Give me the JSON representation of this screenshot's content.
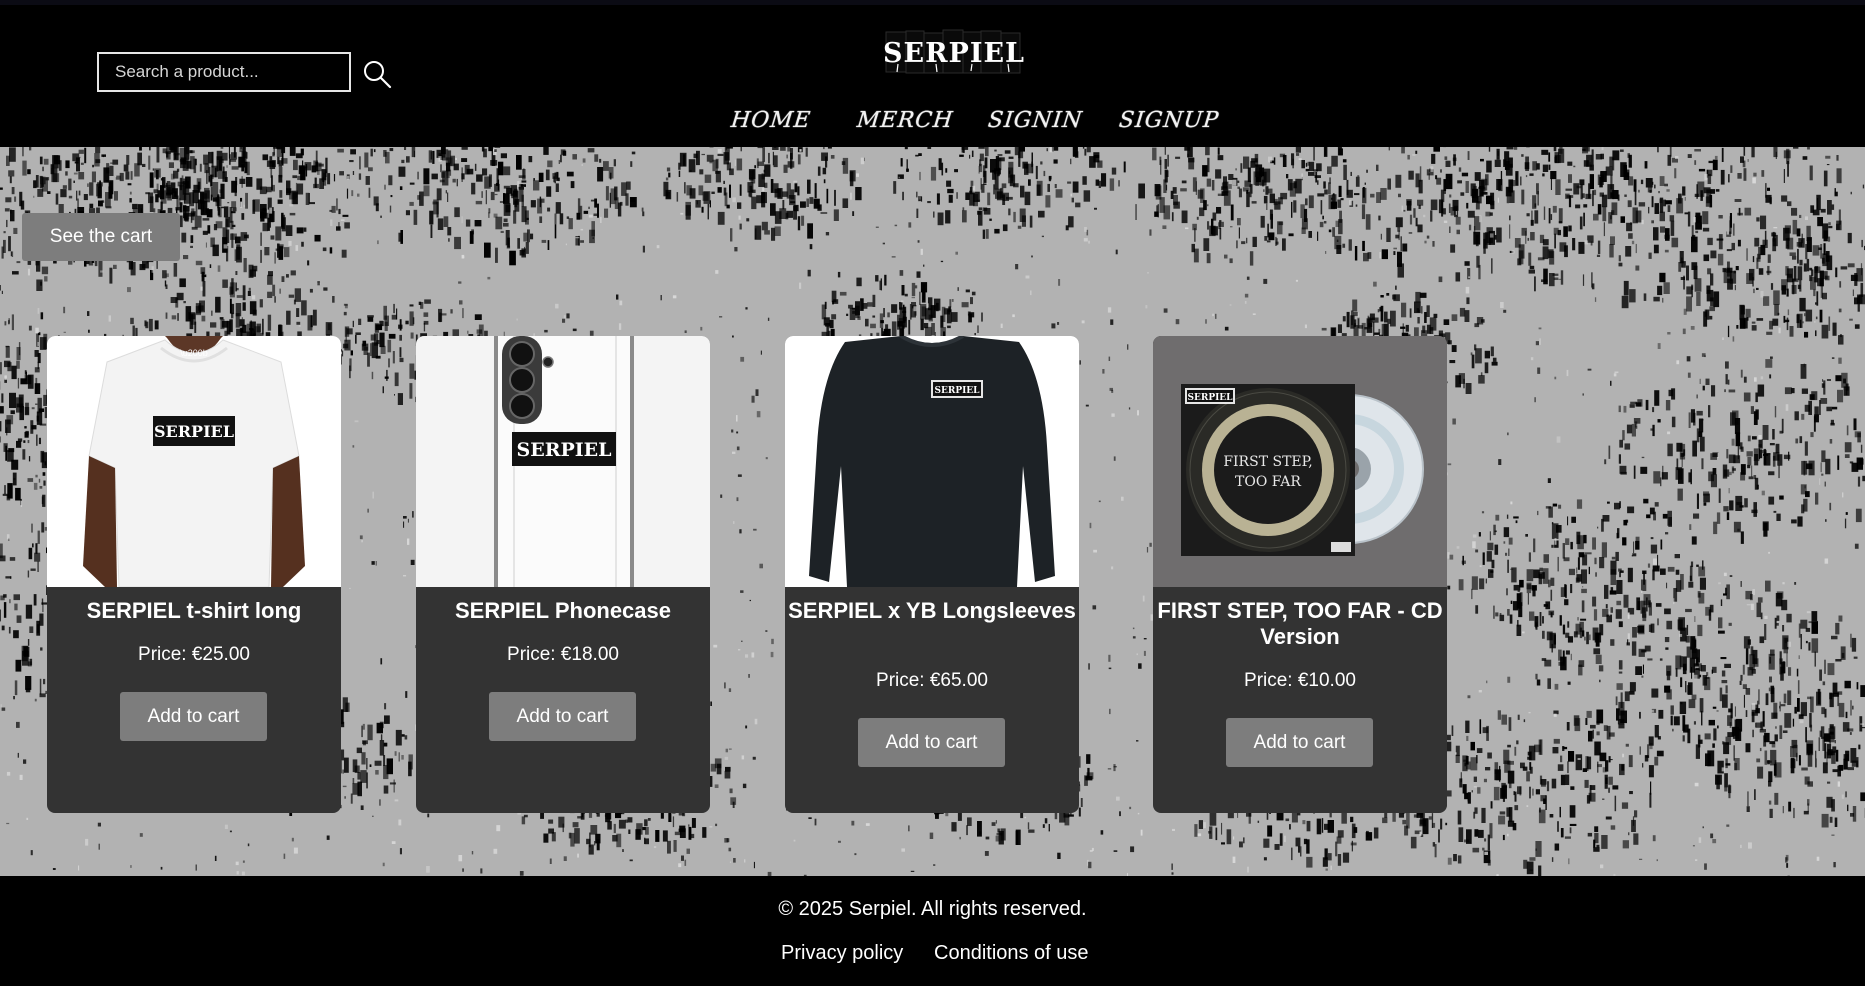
{
  "header": {
    "logo_text": "SERPIEL",
    "search": {
      "placeholder": "Search a product...",
      "value": ""
    },
    "nav": [
      {
        "label": "HOME"
      },
      {
        "label": "MERCH"
      },
      {
        "label": "SIGNIN"
      },
      {
        "label": "SIGNUP"
      }
    ]
  },
  "main": {
    "cart_button_label": "See the cart",
    "products": [
      {
        "title": "SERPIEL t-shirt long",
        "price": "Price: €25.00",
        "button_label": "Add to cart",
        "image": "white t-shirt with SERPIEL print"
      },
      {
        "title": "SERPIEL Phonecase",
        "price": "Price: €18.00",
        "button_label": "Add to cart",
        "image": "white phone case with SERPIEL print"
      },
      {
        "title": "SERPIEL x YB Longsleeves",
        "price": "Price: €65.00",
        "button_label": "Add to cart",
        "image": "black longsleeve shirt"
      },
      {
        "title": "FIRST STEP, TOO FAR - CD Version",
        "price": "Price: €10.00",
        "button_label": "Add to cart",
        "image": "CD album cover",
        "album_text": [
          "FIRST STEP,",
          "TOO FAR"
        ],
        "cover_logo": "SERPIEL"
      }
    ]
  },
  "footer": {
    "copyright": "© 2025 Serpiel. All rights reserved.",
    "links": [
      {
        "label": "Privacy policy"
      },
      {
        "label": "Conditions of use"
      }
    ]
  },
  "colors": {
    "header_bg": "#000000",
    "hero_bg": "#b2b2b2",
    "card_bg": "#333333",
    "button_bg": "#7d7d7d",
    "text": "#ffffff"
  }
}
